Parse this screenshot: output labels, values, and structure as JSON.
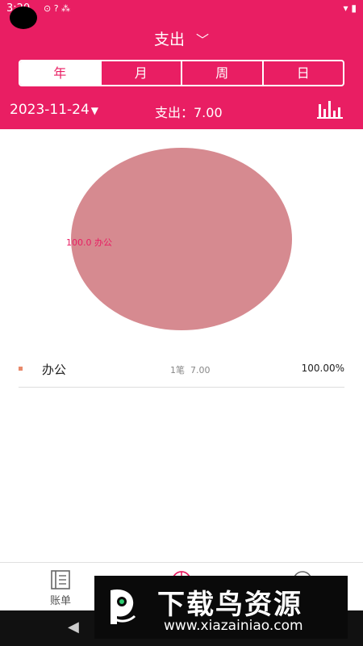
{
  "status": {
    "time": "3:20",
    "left_icons": "⊙ ? ⁂",
    "right_icons": "▾ ▮"
  },
  "header": {
    "title": "支出",
    "tabs": [
      {
        "label": "年",
        "active": true
      },
      {
        "label": "月",
        "active": false
      },
      {
        "label": "周",
        "active": false
      },
      {
        "label": "日",
        "active": false
      }
    ],
    "date": "2023-11-24",
    "total_text": "支出：7.00",
    "chart_toggle_icon": "bar-chart-icon"
  },
  "pie": {
    "slice_label": "100.0   办公",
    "color": "#d68a90"
  },
  "chart_data": {
    "type": "pie",
    "categories": [
      "办公"
    ],
    "values": [
      100.0
    ]
  },
  "legend": [
    {
      "name": "办公",
      "count": "1笔",
      "amount": "7.00",
      "percent": "100.00%",
      "color": "#e8896b"
    }
  ],
  "bottom_nav": [
    {
      "label": "账单",
      "icon": "book-icon"
    },
    {
      "label": "",
      "icon": "pie-chart-icon"
    },
    {
      "label": "",
      "icon": "user-circle-icon"
    }
  ],
  "watermark": {
    "title": "下载鸟资源",
    "url": "www.xiazainiao.com"
  },
  "colors": {
    "accent": "#e91e63"
  }
}
